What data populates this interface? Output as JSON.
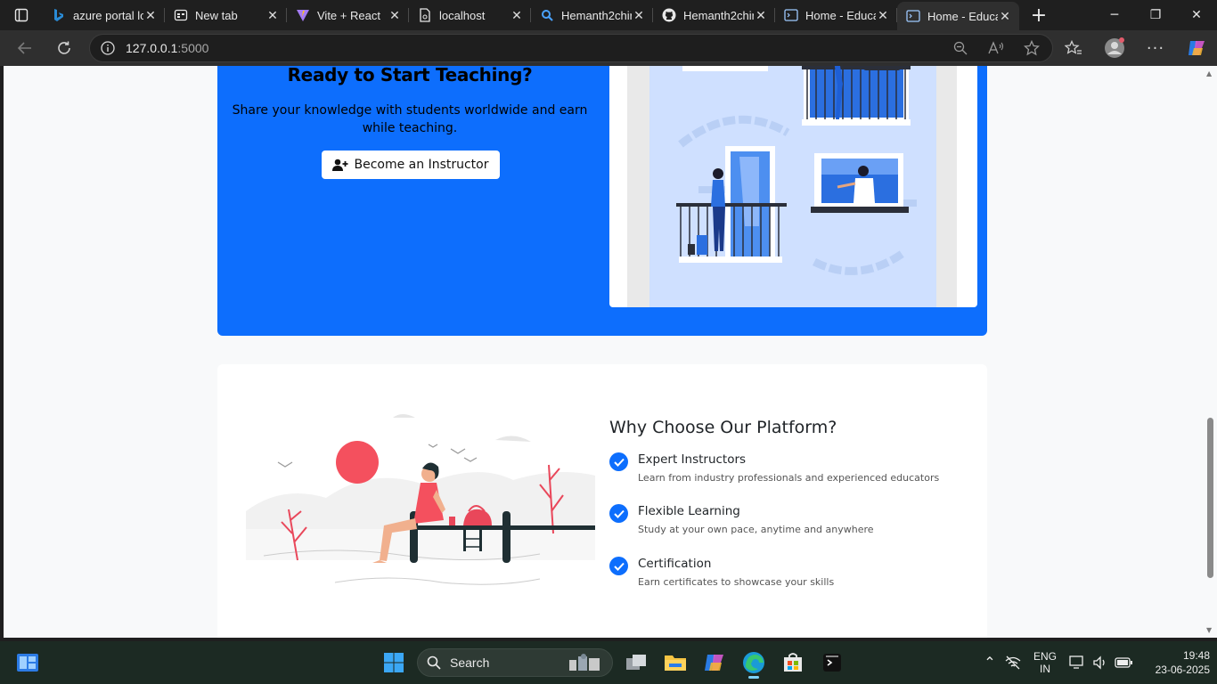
{
  "browser": {
    "tabs": [
      {
        "title": "azure portal lo",
        "icon": "bing-icon"
      },
      {
        "title": "New tab",
        "icon": "newtab-icon"
      },
      {
        "title": "Vite + React",
        "icon": "vite-icon"
      },
      {
        "title": "localhost",
        "icon": "document-icon"
      },
      {
        "title": "Hemanth2chir",
        "icon": "search-icon"
      },
      {
        "title": "Hemanth2chir",
        "icon": "github-icon"
      },
      {
        "title": "Home - Educa",
        "icon": "terminal-icon"
      },
      {
        "title": "Home - Educa",
        "icon": "terminal-icon",
        "active": true
      }
    ],
    "address": {
      "host": "127.0.0.1",
      "port": ":5000"
    }
  },
  "cta": {
    "title": "Ready to Start Teaching?",
    "description": "Share your knowledge with students worldwide and earn while teaching.",
    "button_label": "Become an Instructor"
  },
  "why": {
    "title": "Why Choose Our Platform?",
    "features": [
      {
        "title": "Expert Instructors",
        "desc": "Learn from industry professionals and experienced educators"
      },
      {
        "title": "Flexible Learning",
        "desc": "Study at your own pace, anytime and anywhere"
      },
      {
        "title": "Certification",
        "desc": "Earn certificates to showcase your skills"
      }
    ]
  },
  "taskbar": {
    "search_label": "Search",
    "lang_line1": "ENG",
    "lang_line2": "IN",
    "time": "19:48",
    "date": "23-06-2025"
  },
  "colors": {
    "primary": "#0d6efd",
    "page_bg": "#f8f9fa",
    "taskbar_bg": "#1c2a23"
  }
}
